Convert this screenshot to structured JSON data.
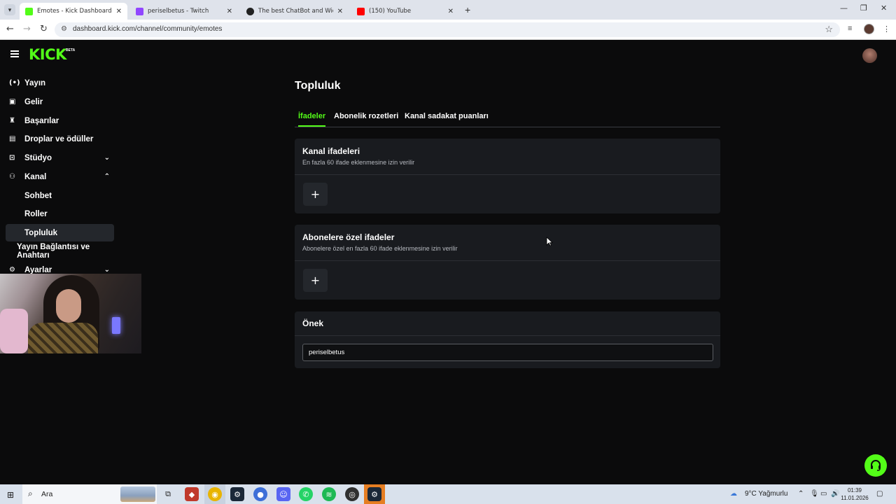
{
  "browser": {
    "tabs": [
      {
        "title": "Emotes - Kick Dashboard",
        "favicon_color": "#53fc18",
        "active": true
      },
      {
        "title": "periselbetus - Twitch",
        "favicon_color": "#9146ff",
        "active": false
      },
      {
        "title": "The best ChatBot and Widgets",
        "favicon_color": "#222222",
        "active": false
      },
      {
        "title": "(150) YouTube",
        "favicon_color": "#ff0000",
        "active": false
      }
    ],
    "url": "dashboard.kick.com/channel/community/emotes"
  },
  "kick": {
    "logo": "KICK",
    "beta": "BETA",
    "sidebar": {
      "items": [
        {
          "label": "Yayın",
          "icon": "broadcast-icon"
        },
        {
          "label": "Gelir",
          "icon": "revenue-icon"
        },
        {
          "label": "Başarılar",
          "icon": "trophy-icon"
        },
        {
          "label": "Droplar ve ödüller",
          "icon": "gift-icon"
        },
        {
          "label": "Stüdyo",
          "icon": "studio-icon"
        },
        {
          "label": "Kanal",
          "icon": "channel-icon"
        }
      ],
      "sub_items": [
        "Sohbet",
        "Roller",
        "Topluluk"
      ],
      "stream_key": "Yayın Bağlantısı ve Anahtarı",
      "settings": "Ayarlar"
    },
    "main": {
      "title": "Topluluk",
      "tabs": [
        "İfadeler",
        "Abonelik rozetleri",
        "Kanal sadakat puanları"
      ],
      "channel_emotes": {
        "title": "Kanal ifadeleri",
        "subtitle": "En fazla 60 ifade eklenmesine izin verilir"
      },
      "sub_emotes": {
        "title": "Abonelere özel ifadeler",
        "subtitle": "Abonelere özel en fazla 60 ifade eklenmesine izin verilir"
      },
      "prefix": {
        "title": "Önek",
        "value": "periselbetus"
      }
    }
  },
  "taskbar": {
    "search_placeholder": "Ara",
    "weather": "9°C  Yağmurlu",
    "time": "01:39",
    "date": "11.01.2026"
  },
  "colors": {
    "accent": "#53fc18",
    "page_bg": "#0b0b0c",
    "card_bg": "#191b1f"
  }
}
